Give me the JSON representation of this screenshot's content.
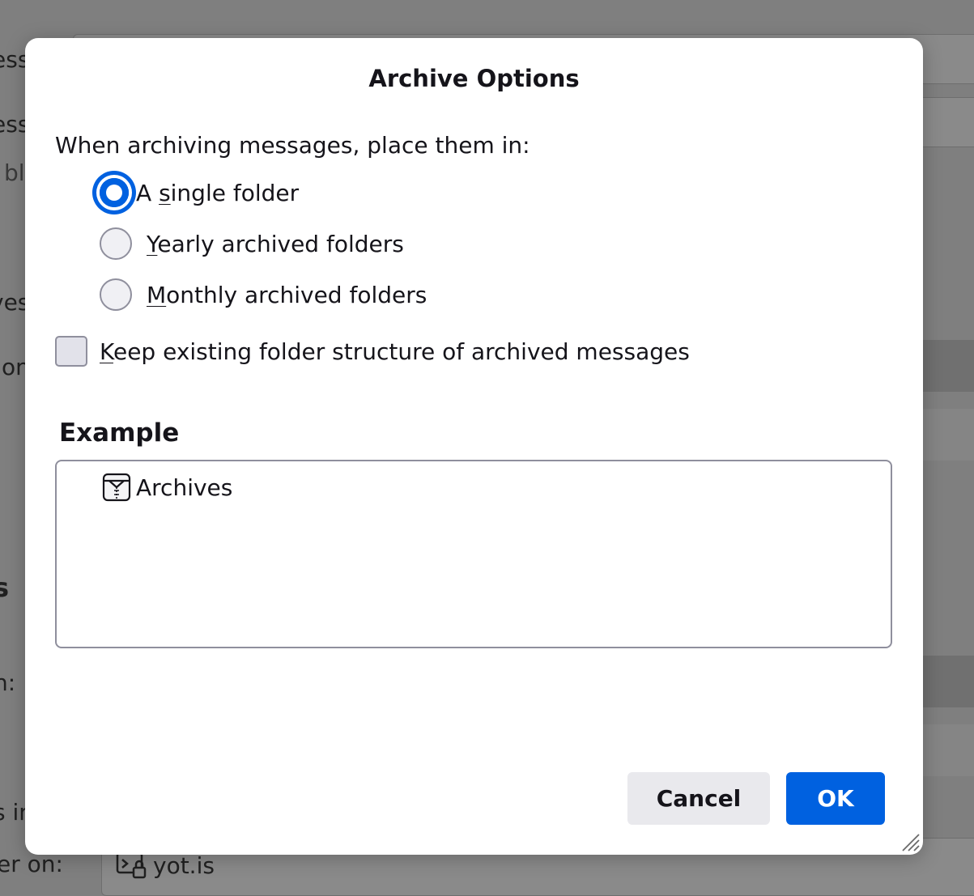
{
  "background": {
    "fragments": [
      "essa",
      "ess:",
      "bla",
      "ves",
      "on",
      "s",
      "n:",
      "s in",
      "er on:"
    ],
    "server_name": "yot.is"
  },
  "dialog": {
    "title": "Archive Options",
    "prompt": "When archiving messages, place them in:",
    "options": [
      {
        "pre": "A ",
        "key": "s",
        "post": "ingle folder",
        "checked": true
      },
      {
        "pre": "",
        "key": "Y",
        "post": "early archived folders",
        "checked": false
      },
      {
        "pre": "",
        "key": "M",
        "post": "onthly archived folders",
        "checked": false
      }
    ],
    "keep_structure": {
      "key": "K",
      "post": "eep existing folder structure of archived messages",
      "checked": false
    },
    "example_heading": "Example",
    "example_tree": [
      {
        "label": "Archives",
        "icon": "archive-folder-icon"
      }
    ],
    "buttons": {
      "cancel": "Cancel",
      "ok": "OK"
    }
  },
  "colors": {
    "accent": "#0061e0",
    "overlay": "#7f7f7f"
  }
}
